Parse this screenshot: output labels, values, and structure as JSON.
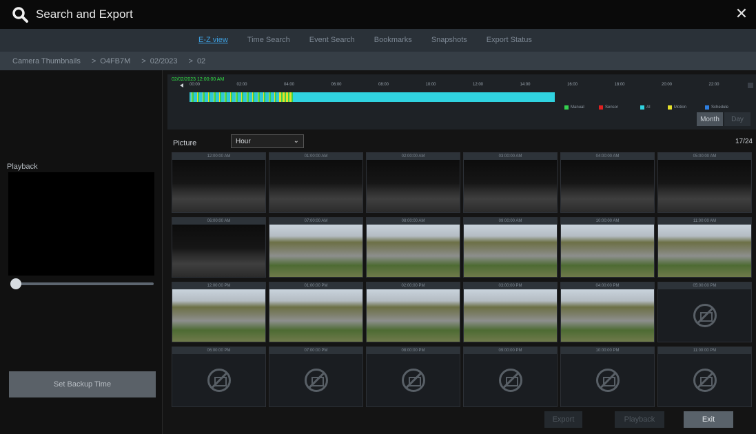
{
  "window": {
    "title": "Search and Export"
  },
  "tabs": [
    {
      "label": "E-Z view",
      "active": true
    },
    {
      "label": "Time Search",
      "active": false
    },
    {
      "label": "Event Search",
      "active": false
    },
    {
      "label": "Bookmarks",
      "active": false
    },
    {
      "label": "Snapshots",
      "active": false
    },
    {
      "label": "Export Status",
      "active": false
    }
  ],
  "breadcrumb": [
    "Camera Thumbnails",
    "O4FB7M",
    "02/2023",
    "02"
  ],
  "left_panel": {
    "playback_label": "Playback",
    "backup_button": "Set Backup Time"
  },
  "timeline": {
    "date": "02/02/2023 12:00:00 AM",
    "hours": [
      "00:00",
      "02:00",
      "04:00",
      "06:00",
      "08:00",
      "10:00",
      "12:00",
      "14:00",
      "16:00",
      "18:00",
      "20:00",
      "22:00",
      "00:00"
    ],
    "legend": [
      {
        "label": "Manual",
        "color": "#35d14f"
      },
      {
        "label": "Sensor",
        "color": "#e02020"
      },
      {
        "label": "AI",
        "color": "#30d3e0"
      },
      {
        "label": "Motion",
        "color": "#e5e02a"
      },
      {
        "label": "Schedule",
        "color": "#2e7fe0"
      }
    ],
    "month_button": "Month",
    "day_button": "Day"
  },
  "picture": {
    "label": "Picture",
    "select_value": "Hour",
    "pager": "17/24"
  },
  "thumbnails": [
    {
      "time": "12:00:00 AM",
      "type": "night"
    },
    {
      "time": "01:00:00 AM",
      "type": "night"
    },
    {
      "time": "02:00:00 AM",
      "type": "night"
    },
    {
      "time": "03:00:00 AM",
      "type": "night"
    },
    {
      "time": "04:00:00 AM",
      "type": "night"
    },
    {
      "time": "05:00:00 AM",
      "type": "night"
    },
    {
      "time": "06:00:00 AM",
      "type": "night"
    },
    {
      "time": "07:00:00 AM",
      "type": "day"
    },
    {
      "time": "08:00:00 AM",
      "type": "day"
    },
    {
      "time": "09:00:00 AM",
      "type": "day"
    },
    {
      "time": "10:00:00 AM",
      "type": "day"
    },
    {
      "time": "11:00:00 AM",
      "type": "day"
    },
    {
      "time": "12:00:00 PM",
      "type": "day"
    },
    {
      "time": "01:00:00 PM",
      "type": "day"
    },
    {
      "time": "02:00:00 PM",
      "type": "day"
    },
    {
      "time": "03:00:00 PM",
      "type": "day"
    },
    {
      "time": "04:00:00 PM",
      "type": "day"
    },
    {
      "time": "05:00:00 PM",
      "type": "none"
    },
    {
      "time": "06:00:00 PM",
      "type": "none"
    },
    {
      "time": "07:00:00 PM",
      "type": "none"
    },
    {
      "time": "08:00:00 PM",
      "type": "none"
    },
    {
      "time": "09:00:00 PM",
      "type": "none"
    },
    {
      "time": "10:00:00 PM",
      "type": "none"
    },
    {
      "time": "11:00:00 PM",
      "type": "none"
    }
  ],
  "buttons": {
    "export": "Export",
    "playback": "Playback",
    "exit": "Exit"
  },
  "icons": {
    "title_icon": "search-icon",
    "close_icon": "close-icon"
  }
}
